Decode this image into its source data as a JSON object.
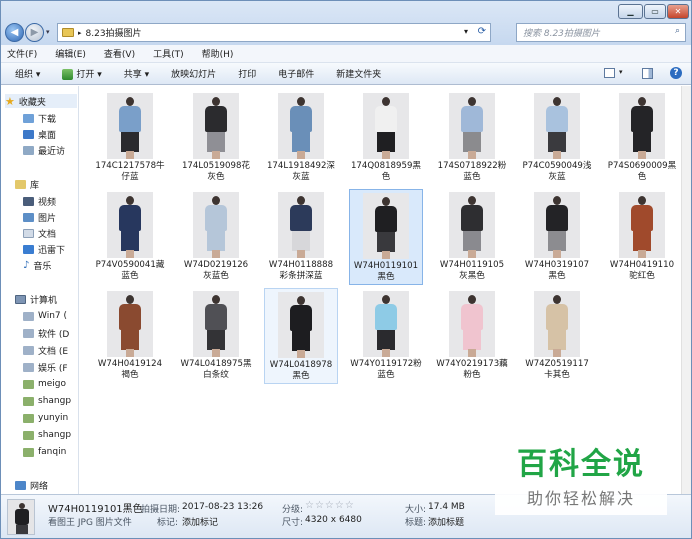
{
  "window": {
    "path": "8.23拍摄图片",
    "search_placeholder": "搜索 8.23拍摄图片",
    "controls": {
      "min": "▁",
      "max": "▭",
      "close": "✕"
    }
  },
  "menu": [
    "文件(F)",
    "编辑(E)",
    "查看(V)",
    "工具(T)",
    "帮助(H)"
  ],
  "toolbar": {
    "organize": "组织 ▾",
    "open": "打开 ▾",
    "share": "共享 ▾",
    "slideshow": "放映幻灯片",
    "print": "打印",
    "email": "电子邮件",
    "newfolder": "新建文件夹"
  },
  "nav": {
    "favorites": {
      "title": "收藏夹",
      "items": [
        "下载",
        "桌面",
        "最近访"
      ]
    },
    "library": {
      "title": "库",
      "items": [
        "视频",
        "图片",
        "文档",
        "迅雷下",
        "音乐"
      ]
    },
    "computer": {
      "title": "计算机",
      "items": [
        "Win7 (",
        "软件 (D",
        "文档 (E",
        "娱乐 (F",
        "meigo",
        "shangp",
        "yunyin",
        "shangp",
        "fanqin"
      ]
    },
    "network": {
      "title": "网络"
    }
  },
  "files": [
    {
      "name": "174C1217578牛仔蓝",
      "top": "#7a9fc9",
      "bottom": "#2a2a2e"
    },
    {
      "name": "174L0519098花灰色",
      "top": "#2b2b2e",
      "bottom": "#8f8f95"
    },
    {
      "name": "174L1918492深灰蓝",
      "top": "#6a8fb8",
      "bottom": "#6a8fb8"
    },
    {
      "name": "174Q0818959黑色",
      "top": "#f0f0f0",
      "bottom": "#1f1f22"
    },
    {
      "name": "174S0718922粉蓝色",
      "top": "#9fb8d8",
      "bottom": "#8b8b8e"
    },
    {
      "name": "P74C0590049浅灰蓝",
      "top": "#a9c2de",
      "bottom": "#3a3a3e"
    },
    {
      "name": "P74S0690009黑色",
      "top": "#242427",
      "bottom": "#242427"
    },
    {
      "name": "P74V0590041藏蓝色",
      "top": "#27375e",
      "bottom": "#27375e"
    },
    {
      "name": "W74D0219126灰蓝色",
      "top": "#b5c6d9",
      "bottom": "#b5c6d9"
    },
    {
      "name": "W74H0118888彩条拼深蓝",
      "top": "#2c3a5a",
      "bottom": "#d7d7da"
    },
    {
      "name": "W74H0119101黑色",
      "top": "#1f1f22",
      "bottom": "#39393d"
    },
    {
      "name": "W74H0119105灰黑色",
      "top": "#2e2e31",
      "bottom": "#8a8a8f"
    },
    {
      "name": "W74H0319107黑色",
      "top": "#232326",
      "bottom": "#8c8c90"
    },
    {
      "name": "W74H0419110驼红色",
      "top": "#a04a2c",
      "bottom": "#a04a2c"
    },
    {
      "name": "W74H0419124褐色",
      "top": "#8a4a30",
      "bottom": "#8a4a30"
    },
    {
      "name": "W74L0418975黑白条纹",
      "top": "#505055",
      "bottom": "#333336"
    },
    {
      "name": "W74L0418978黑色",
      "top": "#1d1d20",
      "bottom": "#1d1d20"
    },
    {
      "name": "W74Y0119172粉蓝色",
      "top": "#8ecbe6",
      "bottom": "#2a2a2e"
    },
    {
      "name": "W74Y0219173藕粉色",
      "top": "#f0c4cf",
      "bottom": "#f0c4cf"
    },
    {
      "name": "W74Z0519117卡其色",
      "top": "#d6c2a6",
      "bottom": "#d6c2a6"
    }
  ],
  "details": {
    "filename": "W74H0119101黑色",
    "filetype": "看图王 JPG 图片文件",
    "date_label": "拍摄日期:",
    "date": "2017-08-23 13:26",
    "tag_label": "标记:",
    "tag": "添加标记",
    "rating_label": "分级:",
    "rating": 0,
    "rating_max": 5,
    "size_label": "大小:",
    "size": "17.4 MB",
    "dim_label": "尺寸:",
    "dim": "4320 x 6480",
    "title_label": "标题:",
    "title": "添加标题"
  },
  "watermark": {
    "title": "百科全说",
    "subtitle": "助你轻松解决"
  }
}
